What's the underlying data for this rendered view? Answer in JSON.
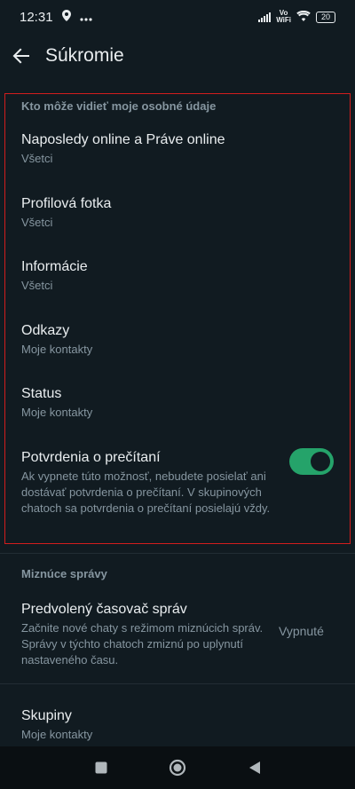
{
  "status": {
    "time": "12:31",
    "vowifi_line1": "Vo",
    "vowifi_line2": "WiFi",
    "battery": "20"
  },
  "header": {
    "title": "Súkromie"
  },
  "section_personal": {
    "title": "Kto môže vidieť moje osobné údaje",
    "items": [
      {
        "title": "Naposledy online a Práve online",
        "value": "Všetci"
      },
      {
        "title": "Profilová fotka",
        "value": "Všetci"
      },
      {
        "title": "Informácie",
        "value": "Všetci"
      },
      {
        "title": "Odkazy",
        "value": "Moje kontakty"
      },
      {
        "title": "Status",
        "value": "Moje kontakty"
      }
    ],
    "read_receipts": {
      "title": "Potvrdenia o prečítaní",
      "description": "Ak vypnete túto možnosť, nebudete posielať ani dostávať potvrdenia o prečítaní. V skupinových chatoch sa potvrdenia o prečítaní posielajú vždy.",
      "enabled": true
    }
  },
  "section_disappearing": {
    "title": "Miznúce správy",
    "timer": {
      "title": "Predvolený časovač správ",
      "description": "Začnite nové chaty s režimom miznúcich správ. Správy v týchto chatoch zmiznú po uplynutí nastaveného času.",
      "value": "Vypnuté"
    }
  },
  "groups": {
    "title": "Skupiny",
    "value": "Moje kontakty"
  },
  "colors": {
    "background": "#111b21",
    "accent": "#25a36a",
    "highlight": "#d21d1d"
  }
}
